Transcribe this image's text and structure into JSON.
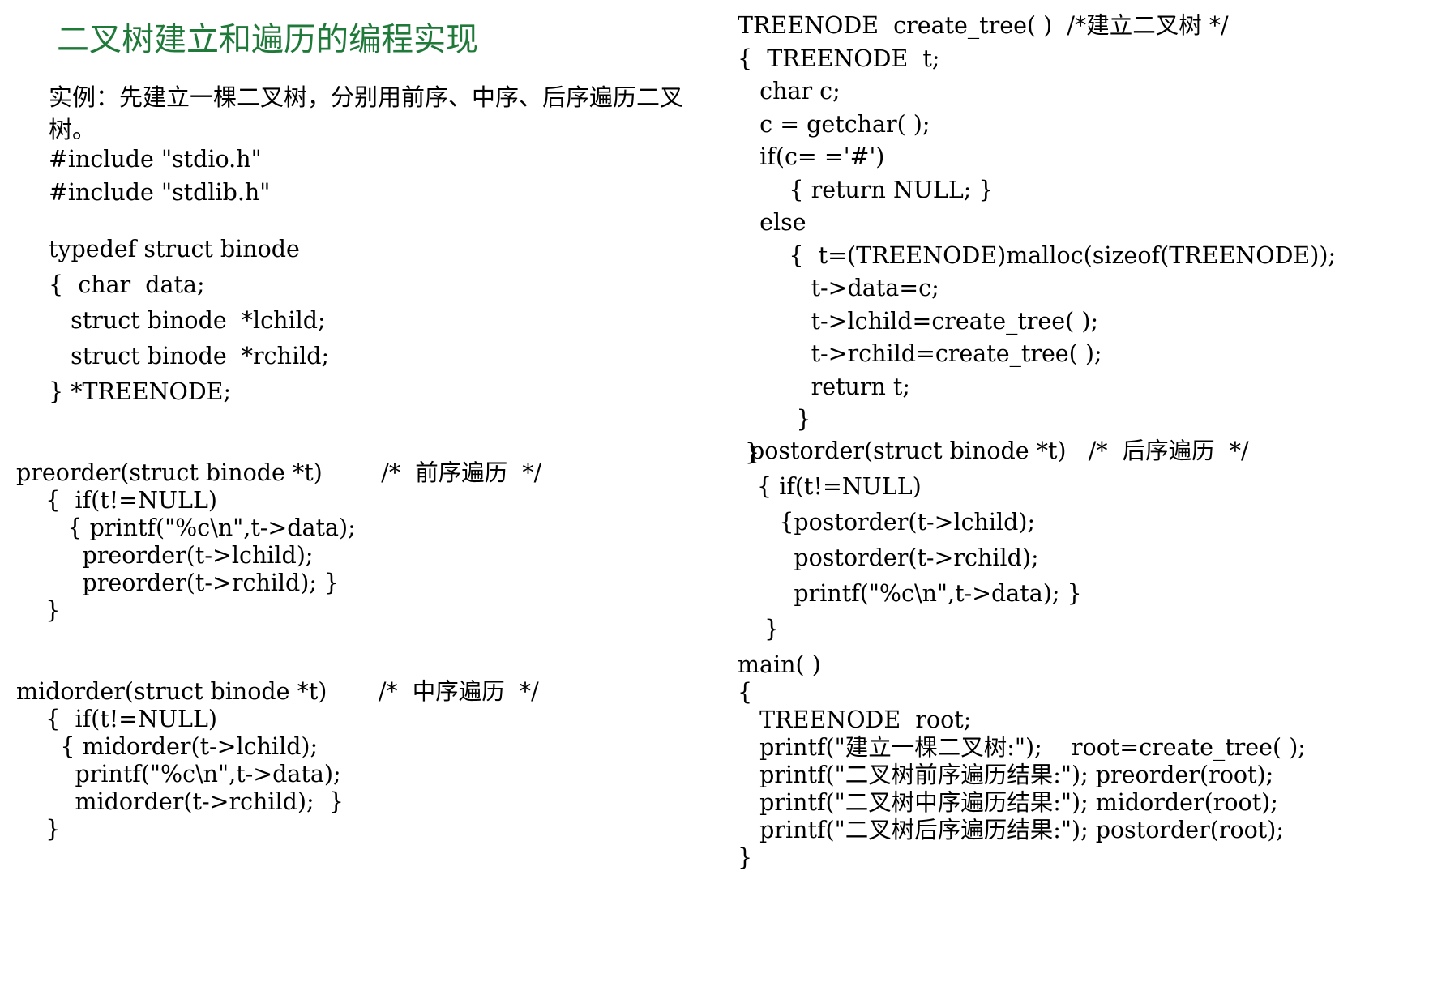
{
  "slide": {
    "title": "二叉树建立和遍历的编程实现",
    "intro": "实例：先建立一棵二叉树，分别用前序、中序、后序遍历二叉树。",
    "blocks": {
      "includes": "#include \"stdio.h\"\n#include \"stdlib.h\"",
      "typedef": "typedef struct binode\n{  char  data;\n   struct binode  *lchild;\n   struct binode  *rchild;\n} *TREENODE;",
      "preorder": "preorder(struct binode *t)        /*  前序遍历  */\n    {  if(t!=NULL)\n       { printf(\"%c\\n\",t->data);\n         preorder(t->lchild);\n         preorder(t->rchild); }\n    }",
      "midorder": "midorder(struct binode *t)       /*  中序遍历  */\n    {  if(t!=NULL)\n      { midorder(t->lchild);\n        printf(\"%c\\n\",t->data);\n        midorder(t->rchild);  }\n    }",
      "create_tree": "TREENODE  create_tree( )  /*建立二叉树 */\n{  TREENODE  t;\n   char c;\n   c = getchar( );\n   if(c= ='#')\n       { return NULL; }\n   else\n       {  t=(TREENODE)malloc(sizeof(TREENODE));\n          t->data=c;\n          t->lchild=create_tree( );\n          t->rchild=create_tree( );\n          return t;\n        }\n }",
      "postorder": "postorder(struct binode *t)   /*  后序遍历  */\n { if(t!=NULL)\n    {postorder(t->lchild);\n      postorder(t->rchild);\n      printf(\"%c\\n\",t->data); }\n  }",
      "main": "main( )\n{\n   TREENODE  root;\n   printf(\"建立一棵二叉树:\");    root=create_tree( );\n   printf(\"二叉树前序遍历结果:\"); preorder(root);\n   printf(\"二叉树中序遍历结果:\"); midorder(root);\n   printf(\"二叉树后序遍历结果:\"); postorder(root);\n}"
    }
  }
}
